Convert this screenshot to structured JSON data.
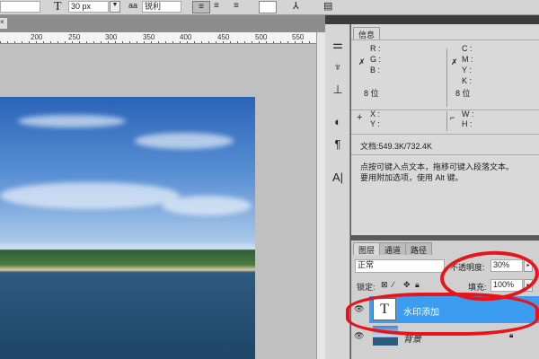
{
  "options_bar": {
    "font_size": "30 px",
    "anti_alias_icon": "aa",
    "anti_alias": "锐利",
    "color_swatch": "#ffffff"
  },
  "ruler": {
    "ticks": [
      "200",
      "250",
      "300",
      "350",
      "400",
      "450",
      "500",
      "550"
    ]
  },
  "info_panel": {
    "tab": "信息",
    "rgb": [
      "R :",
      "G :",
      "B :"
    ],
    "cmyk": [
      "C :",
      "M :",
      "Y :",
      "K :"
    ],
    "bit_left": "8 位",
    "bit_right": "8 位",
    "xy": [
      "X :",
      "Y :"
    ],
    "wh": [
      "W :",
      "H :"
    ],
    "doc": "文档:549.3K/732.4K",
    "hint": [
      "点按可键入点文本，拖移可键入段落文本。",
      "要用附加选项，使用 Alt 键。"
    ]
  },
  "layers_panel": {
    "tabs": [
      "图层",
      "通道",
      "路径"
    ],
    "blend_mode": "正常",
    "opacity_label": "不透明度:",
    "opacity": "30%",
    "lock_label": "锁定:",
    "fill_label": "填充:",
    "fill": "100%",
    "layers": [
      {
        "name": "水印添加",
        "thumb": "T",
        "selected": true
      },
      {
        "name": "背景",
        "selected": false
      }
    ]
  },
  "colors": {
    "selection": "#3b9cf0",
    "annotation": "#e8141b"
  }
}
